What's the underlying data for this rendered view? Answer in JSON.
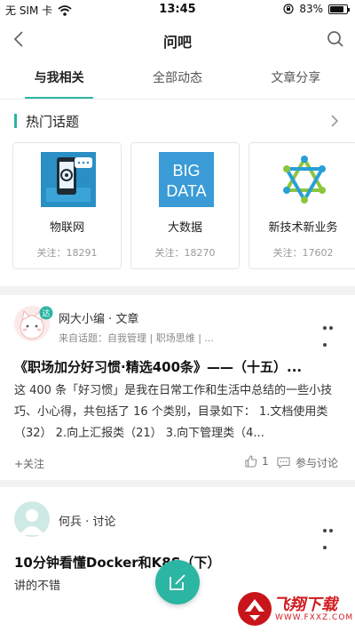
{
  "status_bar": {
    "carrier": "无 SIM 卡",
    "time": "13:45",
    "battery_percent": "83%",
    "battery_level": 0.83
  },
  "nav": {
    "title": "问吧",
    "icons": [
      "back-arrow-icon",
      "search-icon"
    ]
  },
  "tabs": [
    {
      "label": "与我相关",
      "active": true
    },
    {
      "label": "全部动态",
      "active": false
    },
    {
      "label": "文章分享",
      "active": false
    }
  ],
  "hot_topics": {
    "heading": "热门话题",
    "items": [
      {
        "name": "物联网",
        "follow": "关注：18291",
        "icon": "iot-phone-icon"
      },
      {
        "name": "大数据",
        "follow": "关注：18270",
        "icon": "big-data-icon",
        "image_text": [
          "BIG",
          "DATA"
        ]
      },
      {
        "name": "新技术新业务",
        "follow": "关注：17602",
        "icon": "network-star-icon"
      }
    ]
  },
  "posts": [
    {
      "author": "网大小编 · 文章",
      "from": "来自话题：自我管理 | 职场思维 | ...",
      "badge": "达",
      "title": "《职场加分好习惯·精选400条》——（十五）...",
      "body": "这 400 条「好习惯」是我在日常工作和生活中总结的一些小技巧、小心得，共包括了 16 个类别，目录如下： 1.文档使用类（32） 2.向上汇报类（21） 3.向下管理类（4...",
      "follow_label": "+关注",
      "like_count": "1",
      "comment_label": "参与讨论"
    },
    {
      "author": "何兵 · 讨论",
      "title": "10分钟看懂Docker和K8S（下）",
      "body": "讲的不错"
    }
  ],
  "watermark": {
    "brand": "飞翔下载",
    "url": "WWW.FXXZ.COM"
  },
  "colors": {
    "accent": "#2bb5a3",
    "watermark_red": "#c8151b"
  }
}
